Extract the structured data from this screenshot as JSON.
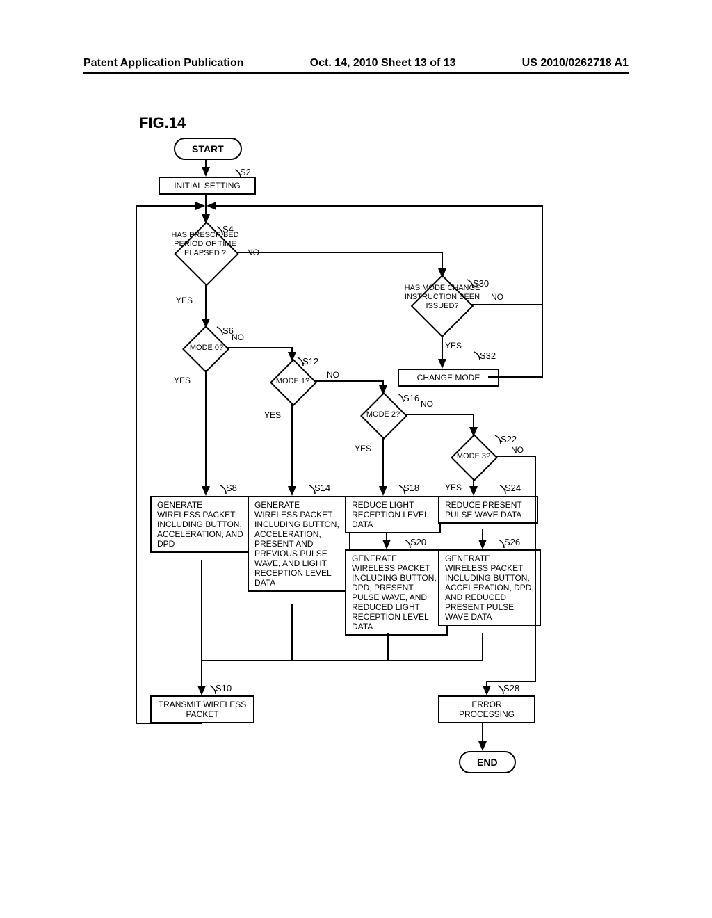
{
  "header": {
    "left": "Patent Application Publication",
    "center": "Oct. 14, 2010  Sheet 13 of 13",
    "right": "US 2010/0262718 A1"
  },
  "figure_label": "FIG.14",
  "nodes": {
    "start": "START",
    "end": "END",
    "s2": "INITIAL SETTING",
    "s4": "HAS PRESCRIBED PERIOD OF TIME ELAPSED ?",
    "s6": "MODE 0?",
    "s8": "GENERATE WIRELESS PACKET INCLUDING BUTTON, ACCELERATION, AND DPD",
    "s10": "TRANSMIT WIRELESS PACKET",
    "s12": "MODE 1?",
    "s14": "GENERATE WIRELESS PACKET INCLUDING BUTTON, ACCELERATION, PRESENT AND PREVIOUS PULSE WAVE, AND LIGHT RECEPTION LEVEL DATA",
    "s16": "MODE 2?",
    "s18": "REDUCE LIGHT RECEPTION LEVEL DATA",
    "s20": "GENERATE WIRELESS PACKET INCLUDING BUTTON, DPD, PRESENT PULSE WAVE, AND REDUCED LIGHT RECEPTION LEVEL DATA",
    "s22": "MODE 3?",
    "s24": "REDUCE PRESENT PULSE WAVE DATA",
    "s26": "GENERATE WIRELESS PACKET INCLUDING BUTTON, ACCELERATION, DPD, AND REDUCED PRESENT PULSE WAVE DATA",
    "s28": "ERROR PROCESSING",
    "s30": "HAS MODE CHANGE INSTRUCTION BEEN ISSUED?",
    "s32": "CHANGE MODE"
  },
  "step_labels": {
    "s2": "S2",
    "s4": "S4",
    "s6": "S6",
    "s8": "S8",
    "s10": "S10",
    "s12": "S12",
    "s14": "S14",
    "s16": "S16",
    "s18": "S18",
    "s20": "S20",
    "s22": "S22",
    "s24": "S24",
    "s26": "S26",
    "s28": "S28",
    "s30": "S30",
    "s32": "S32"
  },
  "edge_labels": {
    "yes": "YES",
    "no": "NO"
  }
}
